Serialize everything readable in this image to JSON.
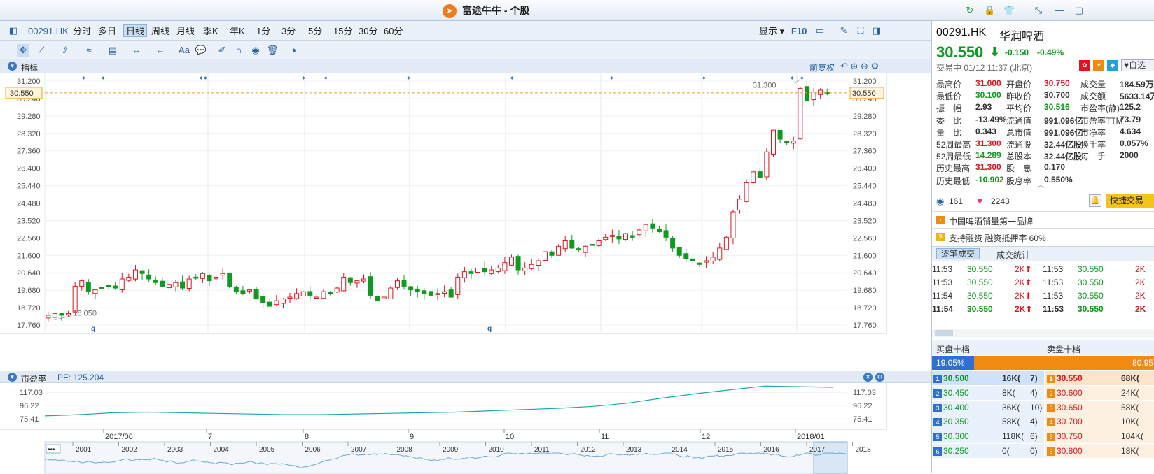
{
  "window": {
    "title": "富途牛牛 - 个股",
    "logo": "futu-logo"
  },
  "toolbar": {
    "code": "00291.HK",
    "periods": [
      "分时",
      "多日",
      "日线",
      "周线",
      "月线",
      "季K",
      "年K",
      "1分",
      "3分",
      "5分",
      "15分",
      "30分",
      "60分"
    ],
    "active_period": "日线",
    "display": "显示",
    "f10": "F10"
  },
  "panel": {
    "indicator_title": "指标",
    "adjust": "前复权",
    "pe_title": "市盈率",
    "pe_value": "PE: 125.204"
  },
  "kline": {
    "y_ticks": [
      "31.200",
      "30.240",
      "29.280",
      "28.320",
      "27.360",
      "26.400",
      "25.440",
      "24.480",
      "23.520",
      "22.560",
      "21.600",
      "20.640",
      "19.680",
      "18.720",
      "17.760"
    ],
    "current_price_tag": "30.550",
    "high_label": "31.300",
    "low_label": "18.050",
    "event_markers": [
      "q",
      "q"
    ]
  },
  "pe": {
    "y_ticks": [
      "117.03",
      "96.22",
      "75.41"
    ]
  },
  "timeline": {
    "months": [
      "2017/06",
      "7",
      "8",
      "9",
      "10",
      "11",
      "12",
      "2018/01"
    ],
    "years": [
      "2001",
      "2002",
      "2003",
      "2004",
      "2005",
      "2006",
      "2007",
      "2008",
      "2009",
      "2010",
      "2011",
      "2012",
      "2013",
      "2014",
      "2015",
      "2016",
      "2017",
      "2018"
    ],
    "more": "•••"
  },
  "chart_data": [
    {
      "type": "candlestick",
      "title": "",
      "ylim": [
        17.76,
        31.2
      ],
      "ylabel": "",
      "x_range": [
        "2017/06",
        "2018/01"
      ],
      "close": [
        18.3,
        18.4,
        18.3,
        18.4,
        19.9,
        20.2,
        19.6,
        19.7,
        19.8,
        19.9,
        19.8,
        20.3,
        20.4,
        20.8,
        20.6,
        20.3,
        20.1,
        19.9,
        20.0,
        20.1,
        19.8,
        20.3,
        20.4,
        20.6,
        20.2,
        20.4,
        20.6,
        19.9,
        19.6,
        19.5,
        19.7,
        19.2,
        19.0,
        18.8,
        19.1,
        19.2,
        19.3,
        19.5,
        19.6,
        19.4,
        19.3,
        19.6,
        19.5,
        19.8,
        20.4,
        20.1,
        20.2,
        20.3,
        19.4,
        19.1,
        19.3,
        19.8,
        20.2,
        19.9,
        19.7,
        19.6,
        19.5,
        19.4,
        19.5,
        19.6,
        19.3,
        20.4,
        20.7,
        20.6,
        20.9,
        20.7,
        20.8,
        20.9,
        21.2,
        21.5,
        20.8,
        20.9,
        21.1,
        21.3,
        21.8,
        21.6,
        22.1,
        22.4,
        22.0,
        21.9,
        22.1,
        22.2,
        22.4,
        22.6,
        22.7,
        22.5,
        22.8,
        22.6,
        23.0,
        23.3,
        23.1,
        22.9,
        22.6,
        22.0,
        21.6,
        21.4,
        21.3,
        21.1,
        21.3,
        21.5,
        22.0,
        22.6,
        24.0,
        24.7,
        25.6,
        26.2,
        25.9,
        27.3,
        28.5,
        28.0,
        27.8,
        27.9,
        30.8,
        30.1,
        30.6,
        30.7,
        30.55
      ],
      "last_price": 30.55,
      "high": 31.3,
      "low": 18.05
    },
    {
      "type": "line",
      "title": "",
      "series": [
        {
          "name": "PE",
          "values": [
            80,
            82,
            85,
            86,
            85,
            84,
            83,
            82,
            82,
            83,
            84,
            85,
            86,
            88,
            90,
            92,
            95,
            100,
            108,
            115,
            121,
            127,
            126,
            125
          ]
        }
      ],
      "ylim": [
        70,
        125
      ],
      "ylabel": ""
    }
  ],
  "stock": {
    "code": "00291.HK",
    "name": "华润啤酒",
    "price": "30.550",
    "arrow": "⬇",
    "change": "-0.150",
    "change_pct": "-0.49%",
    "status": "交易中 01/12 11:37 (北京)",
    "watch_label": "自选"
  },
  "quote_grid": [
    [
      [
        "最高价",
        "31.000",
        "red"
      ],
      [
        "开盘价",
        "30.750",
        "red"
      ],
      [
        "成交量",
        "184.59万",
        ""
      ]
    ],
    [
      [
        "最低价",
        "30.100",
        "green"
      ],
      [
        "昨收价",
        "30.700",
        ""
      ],
      [
        "成交额",
        "5633.14万",
        ""
      ]
    ],
    [
      [
        "振　幅",
        "2.93",
        ""
      ],
      [
        "平均价",
        "30.516",
        "green"
      ],
      [
        "市盈率(静)",
        "125.2",
        ""
      ]
    ],
    [
      [
        "委　比",
        "-13.49%",
        ""
      ],
      [
        "流通值",
        "991.096亿",
        ""
      ],
      [
        "市盈率TTM",
        "73.79",
        ""
      ]
    ],
    [
      [
        "量　比",
        "0.343",
        ""
      ],
      [
        "总市值",
        "991.096亿",
        ""
      ],
      [
        "市净率",
        "4.634",
        ""
      ]
    ],
    [
      [
        "52周最高",
        "31.300",
        "red"
      ],
      [
        "流通股",
        "32.44亿股",
        ""
      ],
      [
        "换手率",
        "0.057%",
        ""
      ]
    ],
    [
      [
        "52周最低",
        "14.289",
        "green"
      ],
      [
        "总股本",
        "32.44亿股",
        ""
      ],
      [
        "每　手",
        "2000",
        ""
      ]
    ],
    [
      [
        "历史最高",
        "31.300",
        "red"
      ],
      [
        "股　息",
        "0.170",
        ""
      ],
      [
        "",
        "",
        " "
      ]
    ],
    [
      [
        "历史最低",
        "-10.902",
        "green"
      ],
      [
        "股息率",
        "0.550%",
        ""
      ],
      [
        "",
        "",
        " "
      ]
    ]
  ],
  "social": {
    "views": "161",
    "likes": "2243",
    "quick_trade": "快捷交易"
  },
  "tags": [
    "中国啤酒销量第一品牌",
    "支持融资  融资抵押率 60%"
  ],
  "trades": {
    "tabs": [
      "逐笔成交",
      "成交统计"
    ],
    "rows": [
      [
        "11:53",
        "30.550",
        "2K⬆",
        "11:53",
        "30.550",
        "2K"
      ],
      [
        "11:53",
        "30.550",
        "2K⬆",
        "11:53",
        "30.550",
        "2K"
      ],
      [
        "11:54",
        "30.550",
        "2K⬆",
        "11:53",
        "30.550",
        "2K"
      ],
      [
        "11:54",
        "30.550",
        "2K⬆",
        "11:53",
        "30.550",
        "2K"
      ]
    ]
  },
  "orderbook": {
    "bid_title": "买盘十档",
    "ask_title": "卖盘十档",
    "bid_pct": "19.05%",
    "ask_pct": "80.95",
    "bids": [
      [
        "1",
        "30.500",
        "16K",
        "7"
      ],
      [
        "2",
        "30.450",
        "8K",
        "4"
      ],
      [
        "3",
        "30.400",
        "36K",
        "10"
      ],
      [
        "4",
        "30.350",
        "58K",
        "4"
      ],
      [
        "5",
        "30.300",
        "118K",
        "6"
      ],
      [
        "6",
        "30.250",
        "0",
        "0"
      ]
    ],
    "asks": [
      [
        "1",
        "30.550",
        "68K("
      ],
      [
        "2",
        "30.600",
        "24K("
      ],
      [
        "3",
        "30.650",
        "58K("
      ],
      [
        "4",
        "30.700",
        "10K("
      ],
      [
        "5",
        "30.750",
        "104K("
      ],
      [
        "6",
        "30.800",
        "18K("
      ]
    ]
  }
}
